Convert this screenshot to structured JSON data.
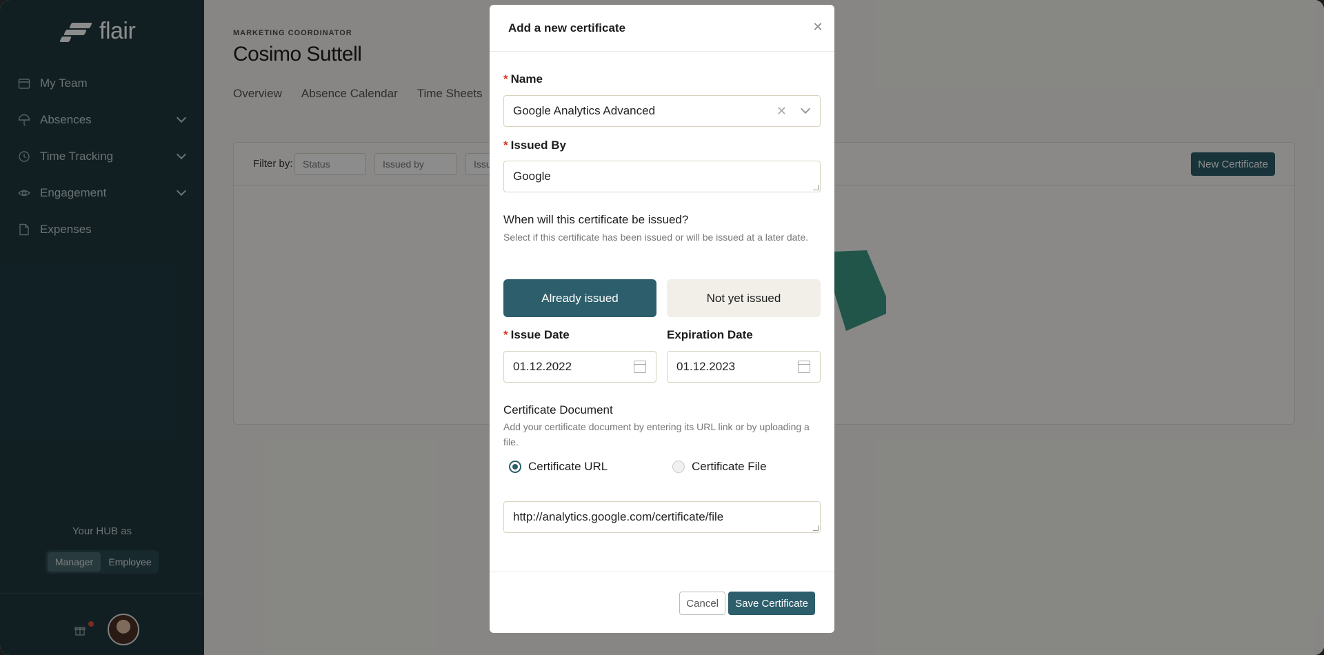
{
  "app": {
    "logo_text": "flair"
  },
  "sidebar": {
    "items": [
      {
        "label": "My Team",
        "icon": "calendar-icon"
      },
      {
        "label": "Absences",
        "icon": "umbrella-icon"
      },
      {
        "label": "Time Tracking",
        "icon": "clock-icon"
      },
      {
        "label": "Engagement",
        "icon": "eye-icon"
      },
      {
        "label": "Expenses",
        "icon": "document-icon"
      }
    ],
    "hub_label": "Your HUB as",
    "hub_options": [
      "Manager",
      "Employee"
    ],
    "hub_selected": "Manager"
  },
  "page": {
    "role": "MARKETING COORDINATOR",
    "name": "Cosimo Suttell",
    "tabs": [
      "Overview",
      "Absence Calendar",
      "Time Sheets"
    ],
    "filter_label": "Filter by:",
    "filters": [
      "Status",
      "Issued by",
      "Issu"
    ],
    "new_certificate_label": "New Certificate"
  },
  "modal": {
    "title": "Add a new certificate",
    "name_label": "Name",
    "name_value": "Google Analytics Advanced",
    "issued_by_label": "Issued By",
    "issued_by_value": "Google",
    "issue_question": "When will this certificate be issued?",
    "issue_help": "Select if this certificate has been issued or will be issued at a later date.",
    "issue_options": [
      "Already issued",
      "Not yet issued"
    ],
    "issue_selected": "Already issued",
    "issue_date_label": "Issue Date",
    "issue_date_value": "01.12.2022",
    "expiration_date_label": "Expiration Date",
    "expiration_date_value": "01.12.2023",
    "document_title": "Certificate Document",
    "document_help": "Add your certificate document by entering its URL link or by uploading a file.",
    "document_options": [
      "Certificate URL",
      "Certificate File"
    ],
    "document_selected": "Certificate URL",
    "url_value": "http://analytics.google.com/certificate/file",
    "cancel_label": "Cancel",
    "save_label": "Save Certificate"
  },
  "colors": {
    "sidebar": "#1f3a41",
    "primary": "#2d5e6b",
    "required": "#d9341e"
  }
}
